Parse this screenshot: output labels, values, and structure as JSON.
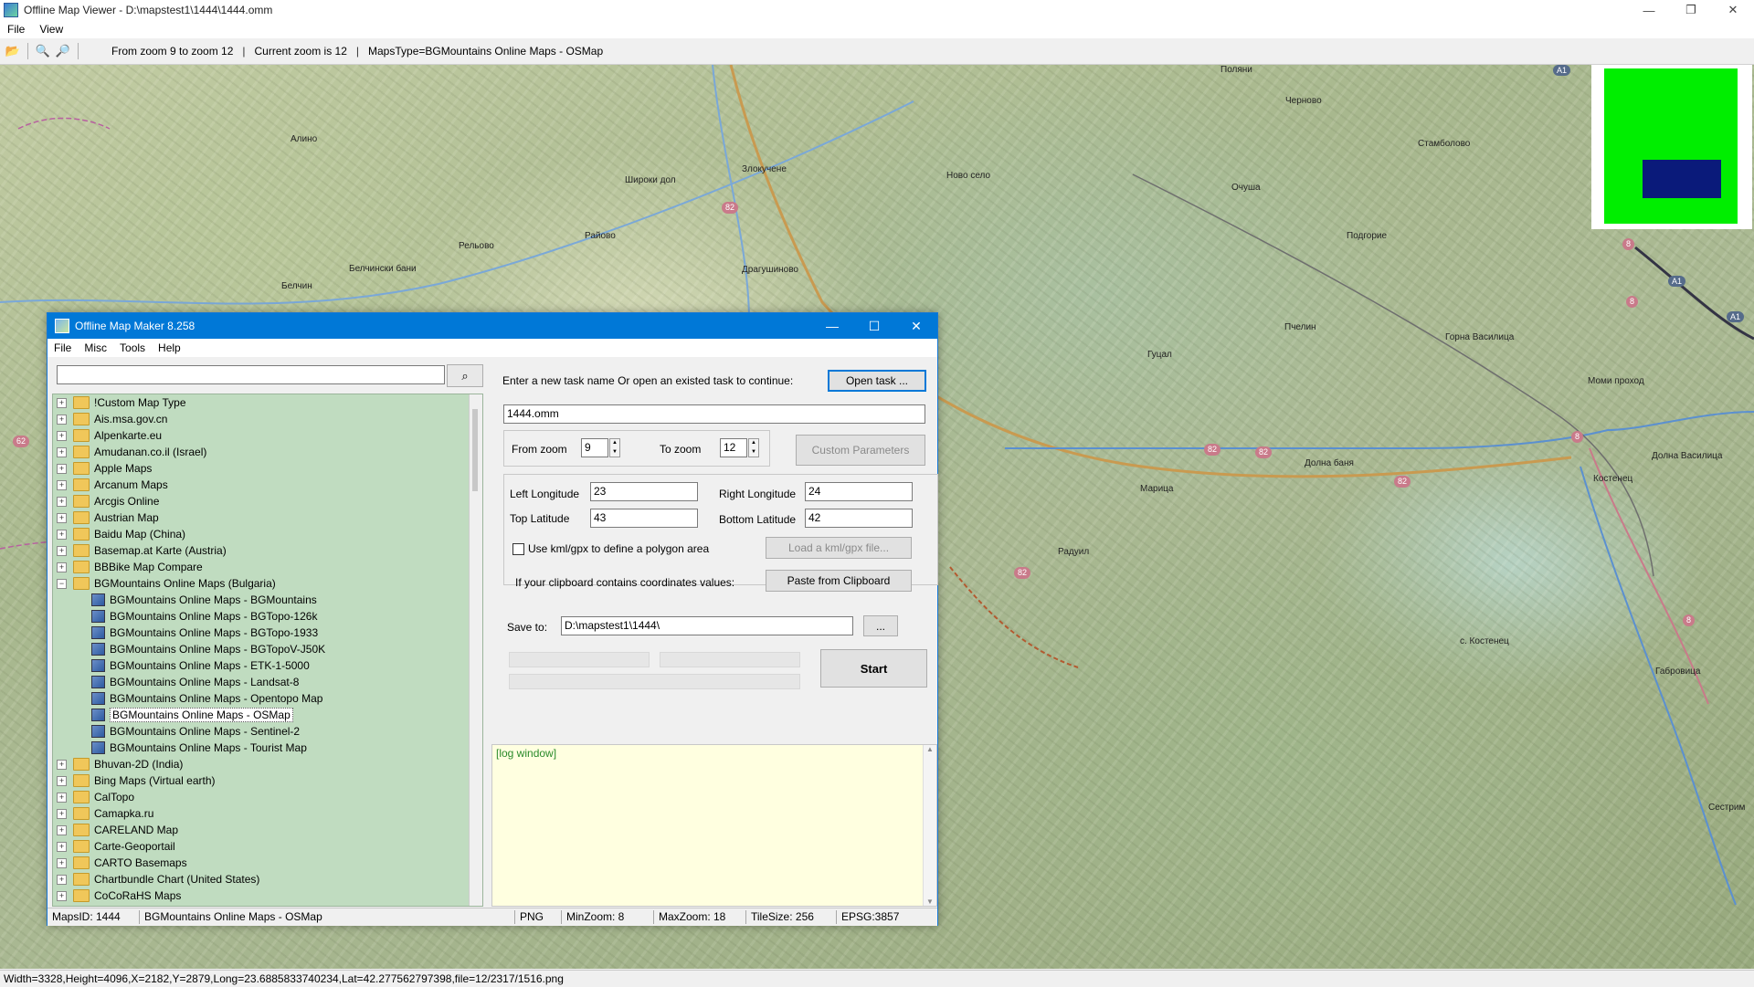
{
  "viewer": {
    "title": "Offline Map Viewer - D:\\mapstest1\\1444\\1444.omm",
    "menu": [
      "File",
      "View"
    ],
    "toolbar": {
      "zoom_range": "From zoom 9 to zoom 12",
      "current_zoom": "Current zoom is 12",
      "maps_type": "MapsType=BGMountains Online Maps - OSMap"
    },
    "status": "Width=3328,Height=4096,X=2182,Y=2879,Long=23.6885833740234,Lat=42.277562797398,file=12/2317/1516.png"
  },
  "map": {
    "places": [
      "Алино",
      "Широки дол",
      "Злокучене",
      "Ново село",
      "Райово",
      "Белчински бани",
      "Рельово",
      "Драгушиново",
      "Белчин",
      "Поляни",
      "Черново",
      "Стамболово",
      "Очуша",
      "Подгорие",
      "Пчелин",
      "Горна Василица",
      "Моми проход",
      "Гуцал",
      "Марица",
      "Долна баня",
      "Костенец",
      "Долна Василица",
      "Радуил",
      "с. Костенец",
      "Габровица",
      "Сестрим"
    ],
    "road_badges": [
      "82",
      "82",
      "82",
      "82",
      "82",
      "8",
      "8",
      "8",
      "8",
      "62"
    ],
    "motorway_badges": [
      "A1",
      "A1",
      "A1"
    ],
    "minimap_colors": {
      "frame": "#00ee00",
      "view": "#0a1a7a"
    }
  },
  "dialog": {
    "title": "Offline Map Maker 8.258",
    "menu": [
      "File",
      "Misc",
      "Tools",
      "Help"
    ],
    "search": {
      "value": "",
      "placeholder": ""
    },
    "tree": [
      {
        "label": "!Custom Map Type",
        "type": "folder"
      },
      {
        "label": "Ais.msa.gov.cn",
        "type": "folder"
      },
      {
        "label": "Alpenkarte.eu",
        "type": "folder"
      },
      {
        "label": "Amudanan.co.il (Israel)",
        "type": "folder"
      },
      {
        "label": "Apple Maps",
        "type": "folder"
      },
      {
        "label": "Arcanum Maps",
        "type": "folder"
      },
      {
        "label": "Arcgis Online",
        "type": "folder"
      },
      {
        "label": "Austrian Map",
        "type": "folder"
      },
      {
        "label": "Baidu Map (China)",
        "type": "folder"
      },
      {
        "label": "Basemap.at Karte (Austria)",
        "type": "folder"
      },
      {
        "label": "BBBike Map Compare",
        "type": "folder"
      },
      {
        "label": "BGMountains Online Maps (Bulgaria)",
        "type": "folder-open"
      },
      {
        "label": "BGMountains Online Maps - BGMountains",
        "type": "map"
      },
      {
        "label": "BGMountains Online Maps - BGTopo-126k",
        "type": "map"
      },
      {
        "label": "BGMountains Online Maps - BGTopo-1933",
        "type": "map"
      },
      {
        "label": "BGMountains Online Maps - BGTopoV-J50K",
        "type": "map"
      },
      {
        "label": "BGMountains Online Maps - ETK-1-5000",
        "type": "map"
      },
      {
        "label": "BGMountains Online Maps - Landsat-8",
        "type": "map"
      },
      {
        "label": "BGMountains Online Maps - Opentopo Map",
        "type": "map"
      },
      {
        "label": "BGMountains Online Maps - OSMap",
        "type": "map",
        "selected": true
      },
      {
        "label": "BGMountains Online Maps - Sentinel-2",
        "type": "map"
      },
      {
        "label": "BGMountains Online Maps - Tourist Map",
        "type": "map"
      },
      {
        "label": "Bhuvan-2D (India)",
        "type": "folder"
      },
      {
        "label": "Bing Maps (Virtual earth)",
        "type": "folder"
      },
      {
        "label": "CalTopo",
        "type": "folder"
      },
      {
        "label": "Camapka.ru",
        "type": "folder"
      },
      {
        "label": "CARELAND Map",
        "type": "folder"
      },
      {
        "label": "Carte-Geoportail",
        "type": "folder"
      },
      {
        "label": "CARTO Basemaps",
        "type": "folder"
      },
      {
        "label": "Chartbundle Chart (United States)",
        "type": "folder"
      },
      {
        "label": "CoCoRaHS Maps",
        "type": "folder"
      }
    ],
    "task_prompt": "Enter a new task name Or open an existed task to continue:",
    "open_task_label": "Open task ...",
    "task_name": "1444.omm",
    "from_zoom_label": "From zoom",
    "from_zoom": "9",
    "to_zoom_label": "To zoom",
    "to_zoom": "12",
    "custom_params_label": "Custom Parameters",
    "left_lon_label": "Left Longitude",
    "left_lon": "23",
    "right_lon_label": "Right Longitude",
    "right_lon": "24",
    "top_lat_label": "Top Latitude",
    "top_lat": "43",
    "bottom_lat_label": "Bottom Latitude",
    "bottom_lat": "42",
    "kml_checkbox_label": "Use kml/gpx to define a polygon area",
    "load_kml_label": "Load a kml/gpx file...",
    "clipboard_prompt": "If your clipboard contains coordinates values:",
    "paste_label": "Paste from Clipboard",
    "save_to_label": "Save to:",
    "save_to": "D:\\mapstest1\\1444\\",
    "browse_label": "...",
    "start_label": "Start",
    "log_text": "[log window]",
    "status": {
      "maps_id": "MapsID: 1444",
      "map_name": "BGMountains Online Maps - OSMap",
      "format": "PNG",
      "min_zoom": "MinZoom: 8",
      "max_zoom": "MaxZoom: 18",
      "tile_size": "TileSize: 256",
      "epsg": "EPSG:3857"
    }
  }
}
